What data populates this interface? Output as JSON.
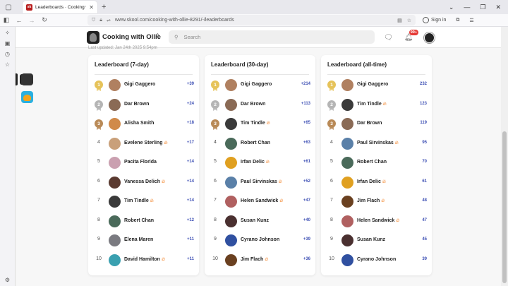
{
  "browser": {
    "tab_title": "Leaderboards · Cooking with Ol",
    "tab_favicon": "sk",
    "url_domain": "www.skool.com",
    "url_path": "/cooking-with-ollie-8291/-/leaderboards",
    "signin_label": "Sign in"
  },
  "header": {
    "community_name": "Cooking with Ollie",
    "search_placeholder": "Search",
    "notification_count": "99+"
  },
  "last_updated": "Last updated: Jan 24th 2025 9:54pm",
  "leaderboards": [
    {
      "title": "Leaderboard (7-day)",
      "rows": [
        {
          "rank": "1",
          "name": "Gigi Gaggero",
          "fire": false,
          "points": "+39",
          "avatar": "#b08060"
        },
        {
          "rank": "2",
          "name": "Dar Brown",
          "fire": false,
          "points": "+24",
          "avatar": "#8a6a55"
        },
        {
          "rank": "3",
          "name": "Alisha Smith",
          "fire": false,
          "points": "+18",
          "avatar": "#d08a4a"
        },
        {
          "rank": "4",
          "name": "Evelene Sterling",
          "fire": true,
          "points": "+17",
          "avatar": "#c9a07a"
        },
        {
          "rank": "5",
          "name": "Pacita Florida",
          "fire": false,
          "points": "+14",
          "avatar": "#caa0b0"
        },
        {
          "rank": "6",
          "name": "Vanessa Delich",
          "fire": true,
          "points": "+14",
          "avatar": "#5a3a30"
        },
        {
          "rank": "7",
          "name": "Tim Tindle",
          "fire": true,
          "points": "+14",
          "avatar": "#3a3a3a"
        },
        {
          "rank": "8",
          "name": "Robert Chan",
          "fire": false,
          "points": "+12",
          "avatar": "#4a6a5a"
        },
        {
          "rank": "9",
          "name": "Elena Maren",
          "fire": false,
          "points": "+11",
          "avatar": "#7a7a80"
        },
        {
          "rank": "10",
          "name": "David Hamilton",
          "fire": true,
          "points": "+11",
          "avatar": "#3aa0b0"
        }
      ]
    },
    {
      "title": "Leaderboard (30-day)",
      "rows": [
        {
          "rank": "1",
          "name": "Gigi Gaggero",
          "fire": false,
          "points": "+214",
          "avatar": "#b08060"
        },
        {
          "rank": "2",
          "name": "Dar Brown",
          "fire": false,
          "points": "+113",
          "avatar": "#8a6a55"
        },
        {
          "rank": "3",
          "name": "Tim Tindle",
          "fire": true,
          "points": "+65",
          "avatar": "#3a3a3a"
        },
        {
          "rank": "4",
          "name": "Robert Chan",
          "fire": false,
          "points": "+63",
          "avatar": "#4a6a5a"
        },
        {
          "rank": "5",
          "name": "Irfan Delic",
          "fire": true,
          "points": "+61",
          "avatar": "#e0a020"
        },
        {
          "rank": "6",
          "name": "Paul Sirvinskas",
          "fire": true,
          "points": "+52",
          "avatar": "#5a80a8"
        },
        {
          "rank": "7",
          "name": "Helen Sandwick",
          "fire": true,
          "points": "+47",
          "avatar": "#b06060"
        },
        {
          "rank": "8",
          "name": "Susan Kunz",
          "fire": false,
          "points": "+40",
          "avatar": "#4a3030"
        },
        {
          "rank": "9",
          "name": "Cyrano Johnson",
          "fire": false,
          "points": "+39",
          "avatar": "#3050a0"
        },
        {
          "rank": "10",
          "name": "Jim Flach",
          "fire": true,
          "points": "+36",
          "avatar": "#6a4020"
        }
      ]
    },
    {
      "title": "Leaderboard (all-time)",
      "rows": [
        {
          "rank": "1",
          "name": "Gigi Gaggero",
          "fire": false,
          "points": "232",
          "avatar": "#b08060"
        },
        {
          "rank": "2",
          "name": "Tim Tindle",
          "fire": true,
          "points": "123",
          "avatar": "#3a3a3a"
        },
        {
          "rank": "3",
          "name": "Dar Brown",
          "fire": false,
          "points": "119",
          "avatar": "#8a6a55"
        },
        {
          "rank": "4",
          "name": "Paul Sirvinskas",
          "fire": true,
          "points": "95",
          "avatar": "#5a80a8"
        },
        {
          "rank": "5",
          "name": "Robert Chan",
          "fire": false,
          "points": "70",
          "avatar": "#4a6a5a"
        },
        {
          "rank": "6",
          "name": "Irfan Delic",
          "fire": true,
          "points": "61",
          "avatar": "#e0a020"
        },
        {
          "rank": "7",
          "name": "Jim Flach",
          "fire": true,
          "points": "48",
          "avatar": "#6a4020"
        },
        {
          "rank": "8",
          "name": "Helen Sandwick",
          "fire": true,
          "points": "47",
          "avatar": "#b06060"
        },
        {
          "rank": "9",
          "name": "Susan Kunz",
          "fire": false,
          "points": "45",
          "avatar": "#4a3030"
        },
        {
          "rank": "10",
          "name": "Cyrano Johnson",
          "fire": false,
          "points": "39",
          "avatar": "#3050a0"
        }
      ]
    }
  ]
}
